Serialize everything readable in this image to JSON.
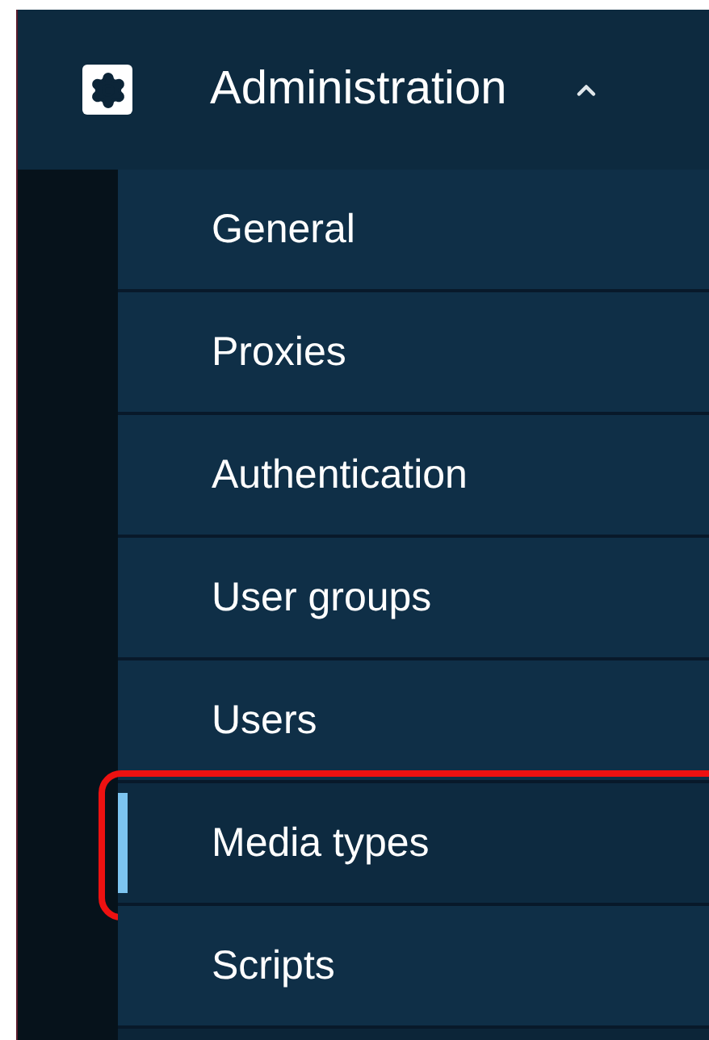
{
  "menu": {
    "title": "Administration",
    "expanded": true,
    "items": [
      {
        "label": "General",
        "selected": false,
        "highlighted": false
      },
      {
        "label": "Proxies",
        "selected": false,
        "highlighted": false
      },
      {
        "label": "Authentication",
        "selected": false,
        "highlighted": false
      },
      {
        "label": "User groups",
        "selected": false,
        "highlighted": false
      },
      {
        "label": "Users",
        "selected": false,
        "highlighted": false
      },
      {
        "label": "Media types",
        "selected": true,
        "highlighted": true
      },
      {
        "label": "Scripts",
        "selected": false,
        "highlighted": false
      }
    ]
  }
}
